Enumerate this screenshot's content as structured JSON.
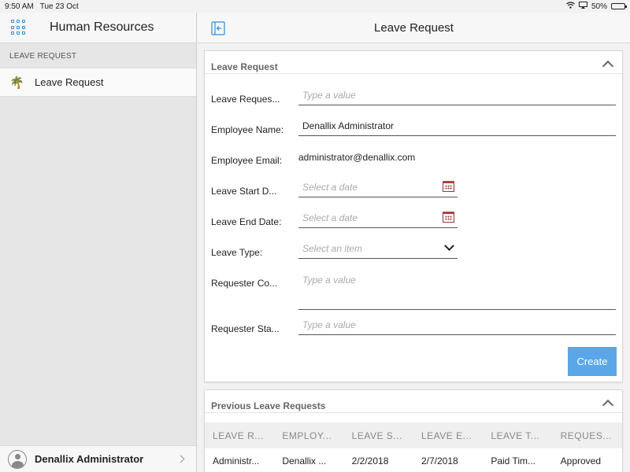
{
  "status_bar": {
    "time": "9:50 AM",
    "date": "Tue 23 Oct",
    "battery": "50%",
    "battery_level": 0.5
  },
  "sidebar": {
    "app_icon": "apps-grid-icon",
    "app_title": "Human Resources",
    "section_label": "LEAVE REQUEST",
    "items": [
      {
        "icon": "palm-tree-icon",
        "label": "Leave Request"
      }
    ],
    "footer": {
      "user_name": "Denallix Administrator"
    }
  },
  "header": {
    "back_icon": "collapse-panel-icon",
    "title": "Leave Request"
  },
  "form": {
    "title": "Leave Request",
    "fields": {
      "leave_request": {
        "label": "Leave Reques...",
        "placeholder": "Type a value",
        "value": ""
      },
      "employee_name": {
        "label": "Employee Name:",
        "value": "Denallix Administrator"
      },
      "employee_email": {
        "label": "Employee Email:",
        "value": "administrator@denallix.com"
      },
      "leave_start": {
        "label": "Leave Start D...",
        "placeholder": "Select a date"
      },
      "leave_end": {
        "label": "Leave End Date:",
        "placeholder": "Select a date"
      },
      "leave_type": {
        "label": "Leave Type:",
        "placeholder": "Select an item"
      },
      "requester_comments": {
        "label": "Requester Co...",
        "placeholder": "Type a value"
      },
      "requester_status": {
        "label": "Requester Sta...",
        "placeholder": "Type a value"
      }
    },
    "create_label": "Create"
  },
  "previous": {
    "title": "Previous Leave Requests",
    "columns": [
      "LEAVE R...",
      "EMPLOY...",
      "LEAVE S...",
      "LEAVE E...",
      "LEAVE T...",
      "REQUES..."
    ],
    "rows": [
      [
        "Administr...",
        "Denallix ...",
        "2/2/2018",
        "2/7/2018",
        "Paid Tim...",
        "Approved"
      ]
    ]
  },
  "colors": {
    "accent": "#2a8fd6",
    "button": "#5aa6e8",
    "calendar": "#b04040"
  }
}
